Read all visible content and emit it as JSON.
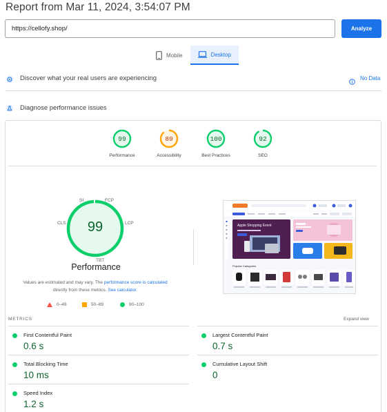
{
  "report": {
    "title": "Report from Mar 11, 2024, 3:54:07 PM"
  },
  "url_bar": {
    "value": "https://cellofy.shop/",
    "analyze_label": "Analyze"
  },
  "device_tabs": [
    {
      "label": "Mobile",
      "icon": "phone-icon",
      "active": false
    },
    {
      "label": "Desktop",
      "icon": "laptop-icon",
      "active": true
    }
  ],
  "crux": {
    "text": "Discover what your real users are experiencing",
    "no_data": "No Data"
  },
  "diagnose": {
    "text": "Diagnose performance issues"
  },
  "categories": [
    {
      "score": "99",
      "label": "Performance",
      "color": "#0cce6b",
      "fraction": 0.99
    },
    {
      "score": "89",
      "label": "Accessibility",
      "color": "#ffa400",
      "fraction": 0.89
    },
    {
      "score": "100",
      "label": "Best Practices",
      "color": "#0cce6b",
      "fraction": 1.0
    },
    {
      "score": "92",
      "label": "SEO",
      "color": "#0cce6b",
      "fraction": 0.92
    }
  ],
  "performance": {
    "score": "99",
    "title": "Performance",
    "metric_tags": {
      "si": "SI",
      "fcp": "FCP",
      "lcp": "LCP",
      "cls": "CLS",
      "tbt": "TBT"
    },
    "estimate_text_1": "Values are estimated and may vary. The ",
    "estimate_link_1": "performance score is calculated",
    "estimate_text_2": "directly from these metrics. ",
    "estimate_link_2": "See calculator."
  },
  "legend": [
    {
      "range": "0–49",
      "color": "#ff4e42",
      "shape": "triangle"
    },
    {
      "range": "50–89",
      "color": "#ffa400",
      "shape": "square"
    },
    {
      "range": "90–100",
      "color": "#0cce6b",
      "shape": "circle"
    }
  ],
  "page_screenshot": {
    "hero_title": "Apple Shopping Event",
    "section_title": "Popular Categories"
  },
  "metrics": {
    "title": "METRICS",
    "expand_label": "Expand view",
    "items": [
      {
        "name": "First Contentful Paint",
        "value": "0.6 s",
        "status": "pass"
      },
      {
        "name": "Largest Contentful Paint",
        "value": "0.7 s",
        "status": "pass"
      },
      {
        "name": "Total Blocking Time",
        "value": "10 ms",
        "status": "pass"
      },
      {
        "name": "Cumulative Layout Shift",
        "value": "0",
        "status": "pass"
      },
      {
        "name": "Speed Index",
        "value": "1.2 s",
        "status": "pass"
      }
    ]
  },
  "colors": {
    "accent": "#1a73e8",
    "pass": "#0cce6b",
    "average": "#ffa400",
    "fail": "#ff4e42"
  }
}
